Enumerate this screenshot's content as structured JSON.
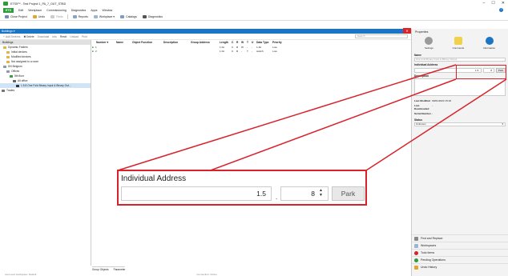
{
  "window": {
    "title": "ETS5™ - Test Project 1_PA_7_OUT_STBD",
    "controls": [
      "–",
      "☐",
      "✕"
    ]
  },
  "menu": {
    "app_button": "ETS",
    "items": [
      "Edit",
      "Workplace",
      "Commissioning",
      "Diagnostics",
      "Apps",
      "Window"
    ]
  },
  "toolbar": {
    "items": [
      {
        "label": "Close Project",
        "icon": "close-project-icon"
      },
      {
        "label": "Undo",
        "icon": "undo-icon"
      },
      {
        "label": "Redo",
        "icon": "redo-icon"
      },
      {
        "label": "Reports",
        "icon": "reports-icon"
      },
      {
        "label": "Workplace ▾",
        "icon": "workplace-icon"
      },
      {
        "label": "Catalogs",
        "icon": "catalogs-icon"
      },
      {
        "label": "Diagnostics",
        "icon": "diagnostics-icon"
      }
    ]
  },
  "buildings_panel": {
    "title": "Buildings ▾",
    "toolbar": [
      "Add Devices",
      "Delete",
      "Download",
      "Info",
      "Reset",
      "Unload",
      "Print"
    ],
    "search_placeholder": "Search",
    "tree_root": "Buildings",
    "tree": [
      {
        "label": "Dynamic Folders",
        "indent": 1
      },
      {
        "label": "Initial devices",
        "indent": 2
      },
      {
        "label": "Modified devices",
        "indent": 2
      },
      {
        "label": "Not assigned to a room",
        "indent": 2
      },
      {
        "label": "DN Belgium",
        "indent": 1
      },
      {
        "label": "Offices",
        "indent": 2
      },
      {
        "label": "5th floor",
        "indent": 3
      },
      {
        "label": "All office",
        "indent": 4
      },
      {
        "label": "1.5.8 One Fold Binary Input & Binary Out...",
        "indent": 5,
        "selected": true
      },
      {
        "label": "Trades",
        "indent": 0
      }
    ],
    "columns": [
      "Number ▾",
      "Name",
      "Object Function",
      "Description",
      "Group Address",
      "Length",
      "C",
      "R",
      "W",
      "T",
      "U",
      "Data Type",
      "Priority"
    ],
    "rows": [
      {
        "number": "1",
        "length": "1 bit",
        "c": "C",
        "r": "R",
        "w": "W",
        "t": "-",
        "u": "-",
        "dtype": "1-bit",
        "priority": "Low"
      },
      {
        "number": "2",
        "length": "1 bit",
        "c": "C",
        "r": "R",
        "w": "-",
        "t": "T",
        "u": "-",
        "dtype": "switch",
        "priority": "Low"
      }
    ],
    "bottom_tabs": [
      "Group Objects",
      "Parameter"
    ],
    "status": [
      "Last used workspace: Default",
      "Connection: Online"
    ]
  },
  "properties": {
    "title": "Properties",
    "tabs": [
      "Settings",
      "Comments",
      "Information"
    ],
    "name_label": "Name",
    "name_placeholder": "One Fold Binary Input & Binary Output",
    "individual_address_label": "Individual Address",
    "address_value": "1.5.",
    "address_device": "8",
    "park_label": "Park",
    "description_label": "Description",
    "last_modified_label": "Last Modified",
    "last_modified_value": "09/01/2020 15:18",
    "last_downloaded_label": "Last Downloaded",
    "last_downloaded_value": "-",
    "serial_label": "Serial Number",
    "serial_value": "-",
    "status_label": "Status",
    "status_value": "Unknown",
    "dock_items": [
      "Find and Replace",
      "Workspaces",
      "Todo Items",
      "Pending Operations",
      "Undo History"
    ]
  },
  "zoom": {
    "title": "Individual Address",
    "value": "1.5",
    "separator": ".",
    "device": "8",
    "park": "Park"
  },
  "colors": {
    "accent": "#1b75c4",
    "brand": "#2e9c3a",
    "highlight": "#d8222b"
  }
}
